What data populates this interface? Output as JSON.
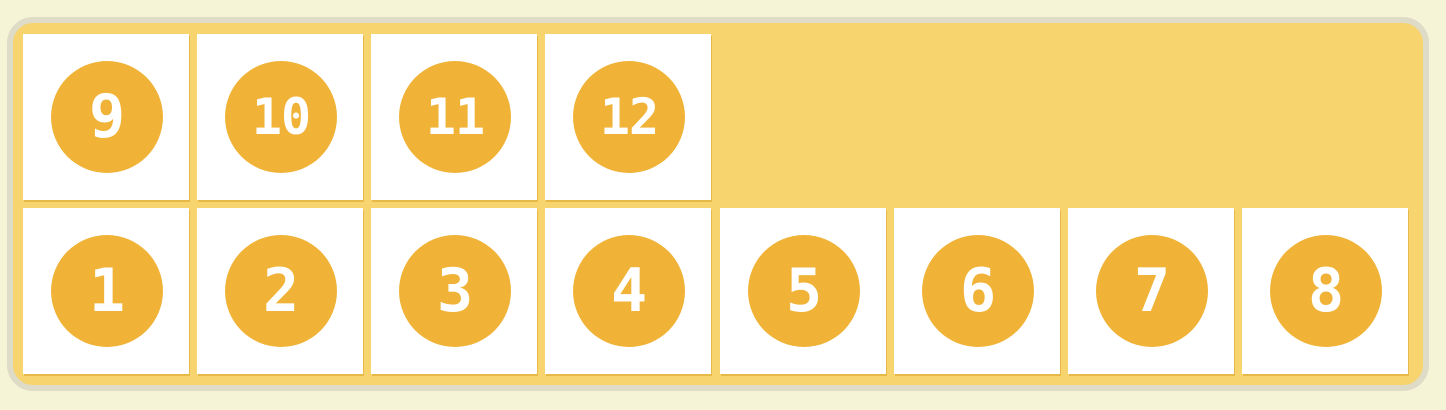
{
  "colors": {
    "background": "#f5f4d7",
    "frame_border": "#dedbc7",
    "tray": "#f7d46d",
    "tile": "#ffffff",
    "badge": "#f0b337",
    "badge_text": "#ffffff"
  },
  "tiles_top_row": [
    "9",
    "10",
    "11",
    "12"
  ],
  "tiles_bottom_row": [
    "1",
    "2",
    "3",
    "4",
    "5",
    "6",
    "7",
    "8"
  ]
}
